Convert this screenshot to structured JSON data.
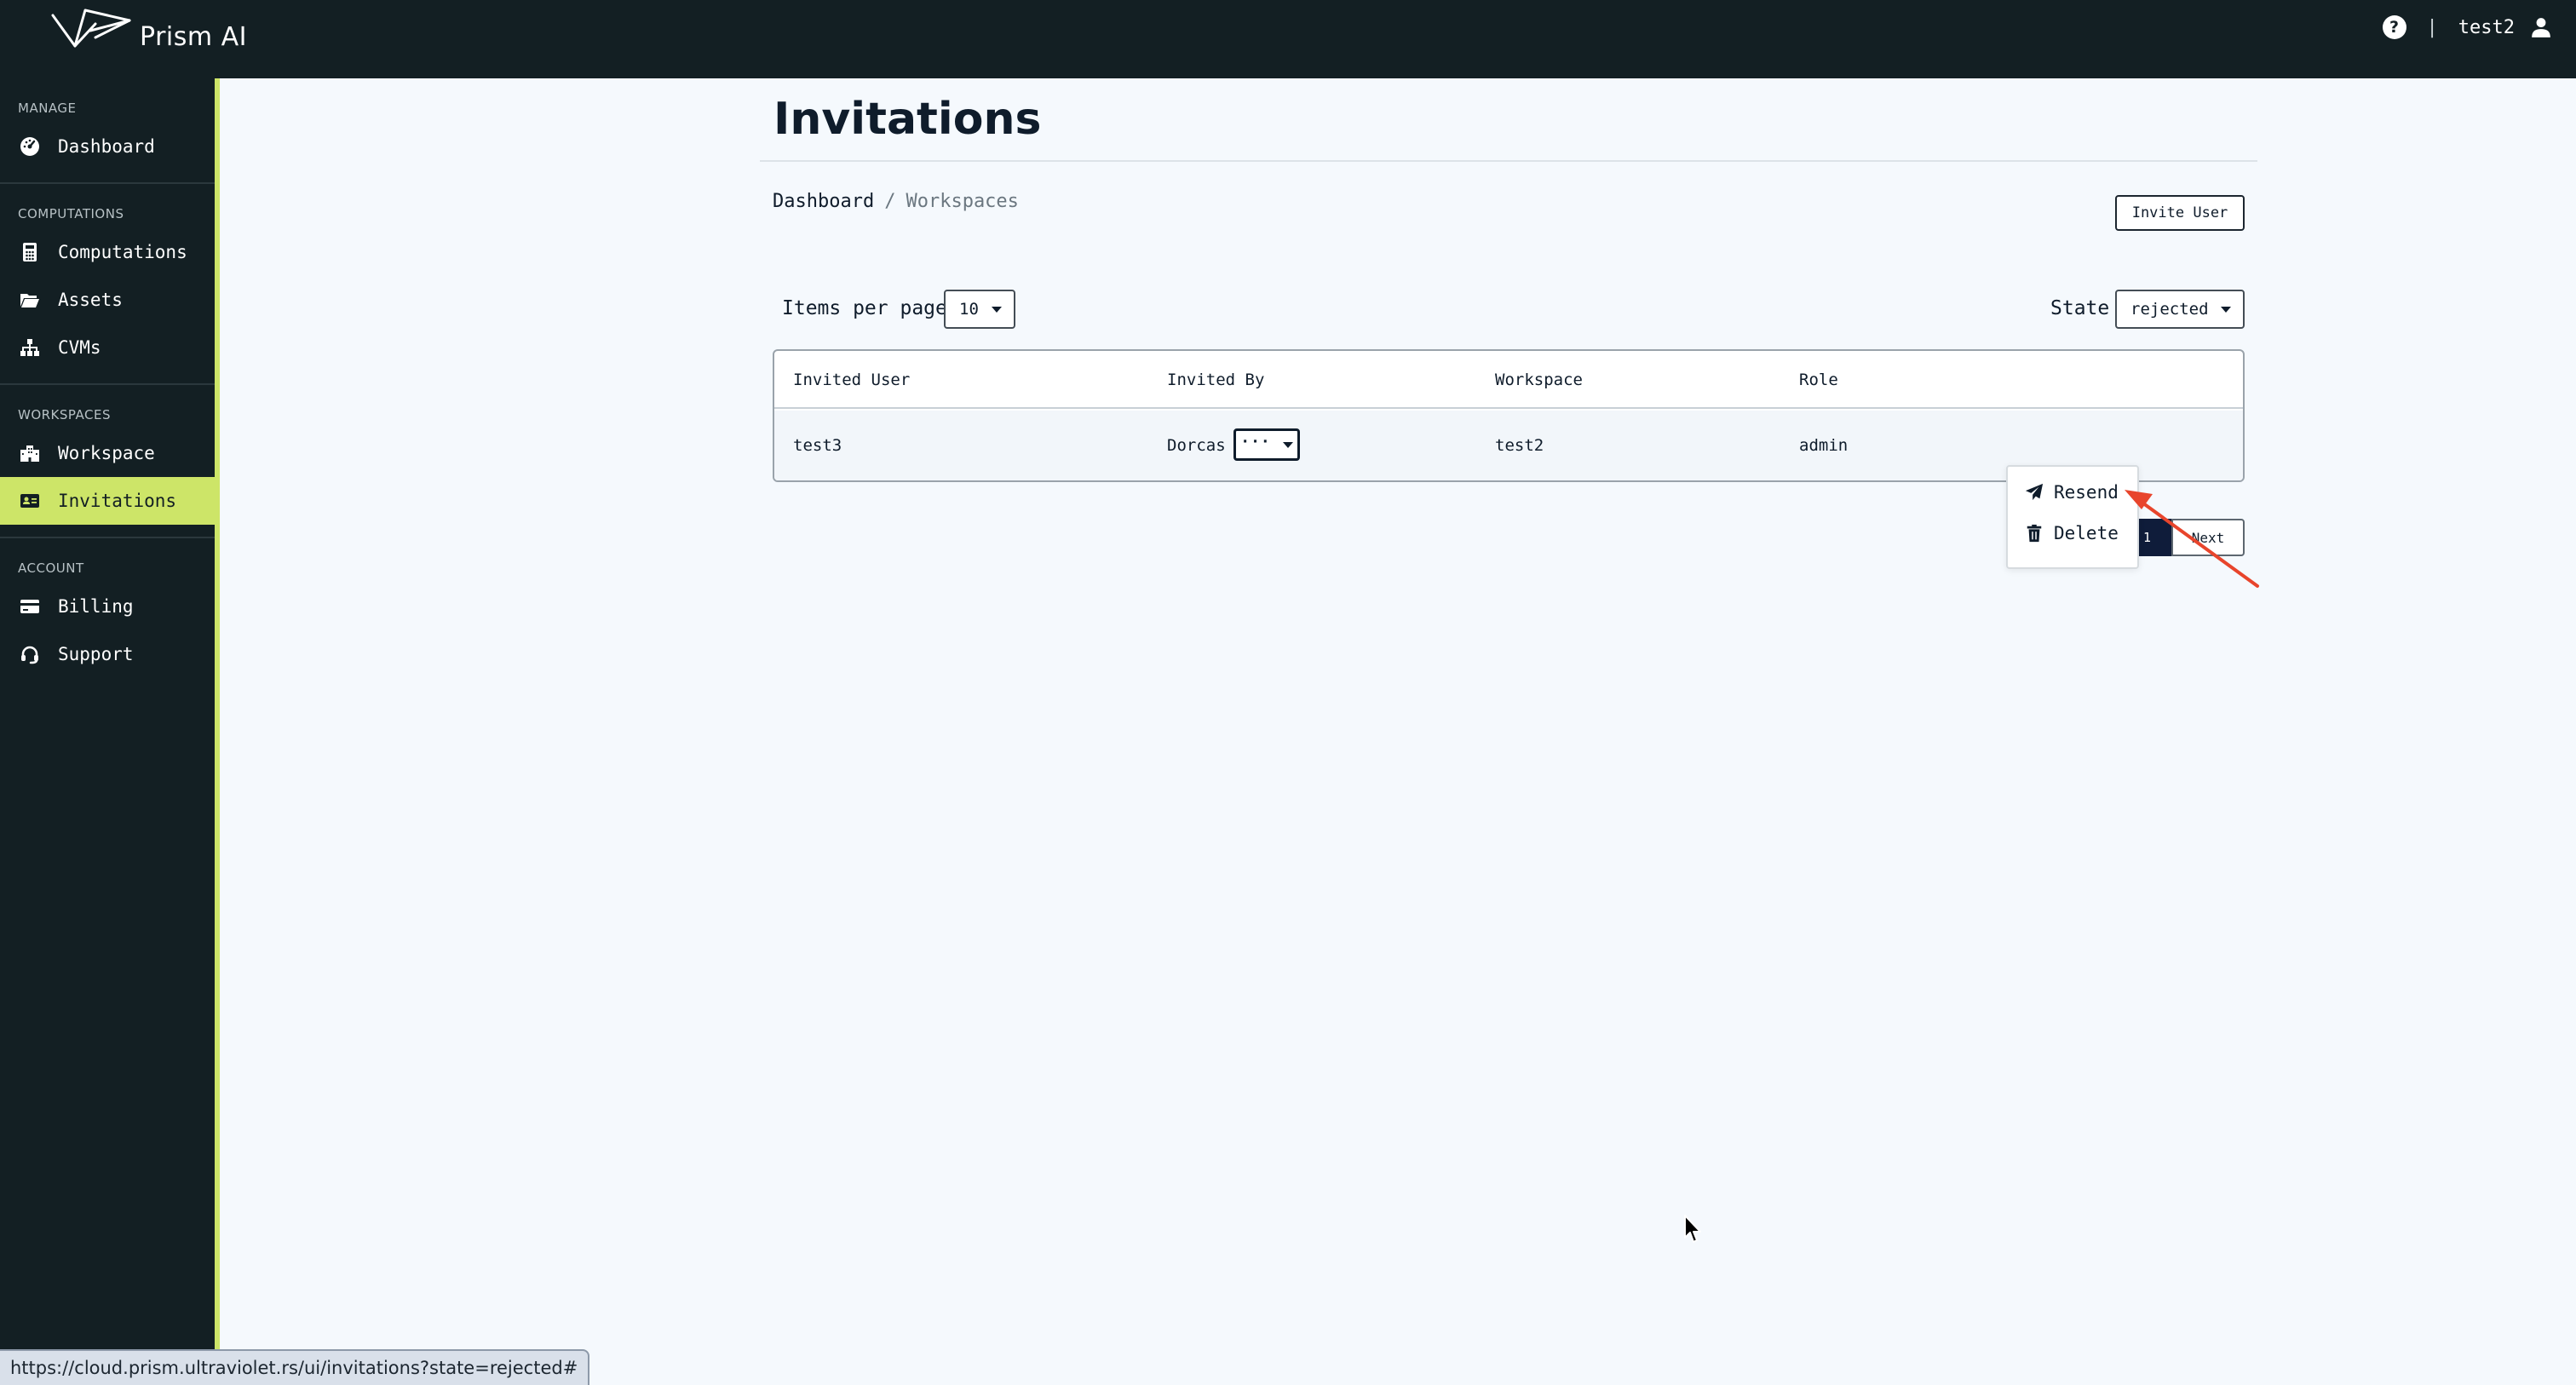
{
  "app": {
    "name": "Prism AI",
    "help_icon": "question-circle-icon",
    "separator": "|",
    "username": "test2",
    "user_icon": "user-icon"
  },
  "sidebar": {
    "sections": [
      {
        "title": "MANAGE",
        "items": [
          {
            "label": "Dashboard",
            "icon": "gauge-icon"
          }
        ]
      },
      {
        "title": "COMPUTATIONS",
        "items": [
          {
            "label": "Computations",
            "icon": "calculator-icon"
          },
          {
            "label": "Assets",
            "icon": "folder-open-icon"
          },
          {
            "label": "CVMs",
            "icon": "sitemap-icon"
          }
        ]
      },
      {
        "title": "WORKSPACES",
        "items": [
          {
            "label": "Workspace",
            "icon": "building-icon"
          },
          {
            "label": "Invitations",
            "icon": "id-card-icon",
            "active": true
          }
        ]
      },
      {
        "title": "ACCOUNT",
        "items": [
          {
            "label": "Billing",
            "icon": "credit-card-icon"
          },
          {
            "label": "Support",
            "icon": "headset-icon"
          }
        ]
      }
    ],
    "active_color": "#cde568"
  },
  "page": {
    "title": "Invitations",
    "breadcrumb": {
      "link": "Dashboard",
      "separator": "/",
      "current": "Workspaces"
    },
    "invite_button": "Invite User",
    "items_per_page": {
      "label": "Items per page",
      "value": "10"
    },
    "state_filter": {
      "label": "State",
      "value": "rejected"
    }
  },
  "table": {
    "columns": [
      "Invited User",
      "Invited By",
      "Workspace",
      "Role"
    ],
    "rows": [
      {
        "invited_user": "test3",
        "invited_by": "Dorcas",
        "workspace": "test2",
        "role": "admin",
        "actions": "···"
      }
    ]
  },
  "row_menu": {
    "items": [
      {
        "label": "Resend",
        "icon": "paper-plane-icon"
      },
      {
        "label": "Delete",
        "icon": "trash-icon"
      }
    ]
  },
  "pagination": {
    "current_page": "1",
    "next_label": "Next"
  },
  "annotation": {
    "color": "#e8452c"
  },
  "status_bar": {
    "url": "https://cloud.prism.ultraviolet.rs/ui/invitations?state=rejected#"
  },
  "colors": {
    "topbar": "#131f23",
    "sidebar": "#131f23",
    "accent": "#cde568",
    "background": "#f5f9fd",
    "page_active": "#0f1c3a"
  }
}
